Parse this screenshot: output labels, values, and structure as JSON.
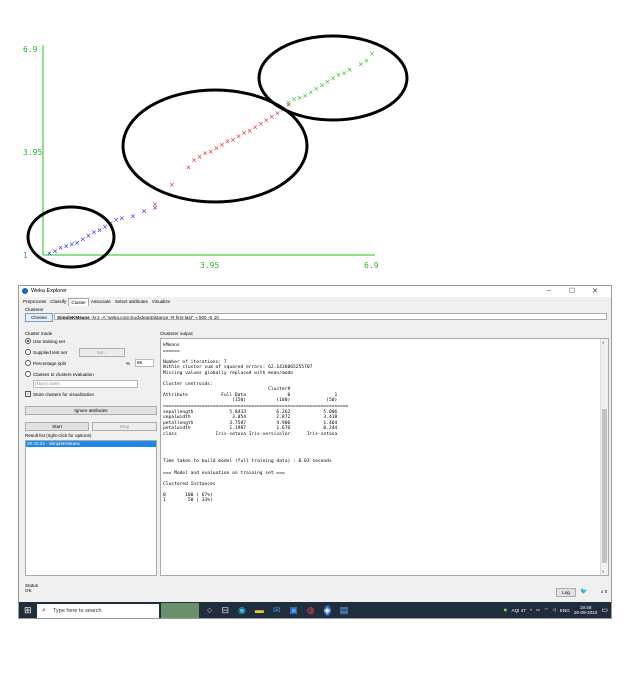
{
  "plot": {
    "y_ticks": [
      "6.9",
      "3.95",
      "1"
    ],
    "x_ticks": [
      "3.95",
      "6.9"
    ],
    "cluster_colors": {
      "blue": "#2020e0",
      "red": "#e02020",
      "green": "#20c020",
      "axis": "#20c020"
    },
    "chart_data": {
      "type": "scatter",
      "xlim": [
        1,
        6.9
      ],
      "ylim": [
        1,
        6.9
      ],
      "series": [
        {
          "color": "#2020e0",
          "points": [
            [
              1.1,
              1.05
            ],
            [
              1.2,
              1.1
            ],
            [
              1.3,
              1.2
            ],
            [
              1.4,
              1.25
            ],
            [
              1.5,
              1.3
            ],
            [
              1.6,
              1.35
            ],
            [
              1.7,
              1.45
            ],
            [
              1.8,
              1.55
            ],
            [
              1.9,
              1.65
            ],
            [
              2.0,
              1.7
            ],
            [
              2.1,
              1.8
            ],
            [
              2.2,
              1.9
            ],
            [
              2.3,
              2.0
            ],
            [
              2.4,
              2.05
            ],
            [
              2.6,
              2.1
            ],
            [
              2.8,
              2.25
            ],
            [
              3.0,
              2.35
            ]
          ]
        },
        {
          "color": "#e02020",
          "points": [
            [
              3.0,
              2.45
            ],
            [
              3.3,
              3.0
            ],
            [
              3.6,
              3.5
            ],
            [
              3.7,
              3.7
            ],
            [
              3.8,
              3.8
            ],
            [
              3.9,
              3.9
            ],
            [
              4.0,
              3.95
            ],
            [
              4.1,
              4.05
            ],
            [
              4.2,
              4.15
            ],
            [
              4.3,
              4.25
            ],
            [
              4.4,
              4.3
            ],
            [
              4.5,
              4.4
            ],
            [
              4.6,
              4.5
            ],
            [
              4.7,
              4.55
            ],
            [
              4.8,
              4.65
            ],
            [
              4.9,
              4.75
            ],
            [
              5.0,
              4.85
            ],
            [
              5.1,
              4.95
            ],
            [
              5.2,
              5.05
            ],
            [
              5.3,
              5.15
            ],
            [
              5.4,
              5.3
            ]
          ]
        },
        {
          "color": "#20c020",
          "points": [
            [
              5.4,
              5.35
            ],
            [
              5.5,
              5.45
            ],
            [
              5.6,
              5.5
            ],
            [
              5.7,
              5.55
            ],
            [
              5.8,
              5.65
            ],
            [
              5.9,
              5.75
            ],
            [
              6.0,
              5.85
            ],
            [
              6.1,
              5.95
            ],
            [
              6.2,
              6.05
            ],
            [
              6.3,
              6.15
            ],
            [
              6.4,
              6.2
            ],
            [
              6.5,
              6.3
            ],
            [
              6.7,
              6.45
            ],
            [
              6.8,
              6.55
            ],
            [
              6.9,
              6.75
            ]
          ]
        }
      ]
    }
  },
  "window": {
    "title": "Weka Explorer",
    "controls": [
      "–",
      "☐",
      "✕"
    ],
    "tabs": [
      "Preprocess",
      "Classify",
      "Cluster",
      "Associate",
      "Select attributes",
      "Visualize"
    ],
    "active_tab": "Cluster",
    "clusterer_label": "Clusterer",
    "choose_label": "Choose",
    "clusterer_name": "SimpleKMeans",
    "clusterer_args": " -N 2 -A \"weka.core.EuclideanDistance -R first-last\" -I 500 -S 10",
    "cluster_mode_label": "Cluster mode",
    "modes": [
      "Use training set",
      "Supplied test set",
      "Percentage split",
      "Classes to clusters evaluation"
    ],
    "set_label": "Set...",
    "percent_sign": "%",
    "percent_value": "66",
    "class_select": "(Nom) class",
    "store_clusters_label": "Store clusters for visualization",
    "ignore_label": "Ignore attributes",
    "start_label": "Start",
    "stop_label": "Stop",
    "result_list_label": "Result list (right-click for options)",
    "result_items": [
      "20:43:22 - SimpleKMeans"
    ],
    "output_label": "Clusterer output",
    "output_text": "kMeans\n======\n\nNumber of iterations: 7\nWithin cluster sum of squared errors: 62.1436065255707\nMissing values globally replaced with mean/mode\n\nCluster centroids:\n                                      Cluster#\nAttribute            Full Data               0                1\n                         (150)           (100)             (50)\n===================================================================\nsepallength             5.8433           6.262            5.006\nsepalwidth               3.054           2.872            3.418\npetallength             3.7587           4.906            1.464\npetalwidth              1.1987           1.676            0.244\nclass              Iris-setosa Iris-versicolor      Iris-setosa\n\n\n\n\nTime taken to build model (full training data) : 0.03 seconds\n\n=== Model and evaluation on training set ===\n\nClustered Instances\n\n0       100 ( 67%)\n1        50 ( 33%)",
    "status_label": "Status",
    "status_value": "OK",
    "log_label": "Log",
    "x_count": "x 0"
  },
  "taskbar": {
    "search_placeholder": "Type here to search",
    "aqi": "AQI 47",
    "lang": "ENG",
    "time": "19:48",
    "date": "26-09-2022"
  }
}
